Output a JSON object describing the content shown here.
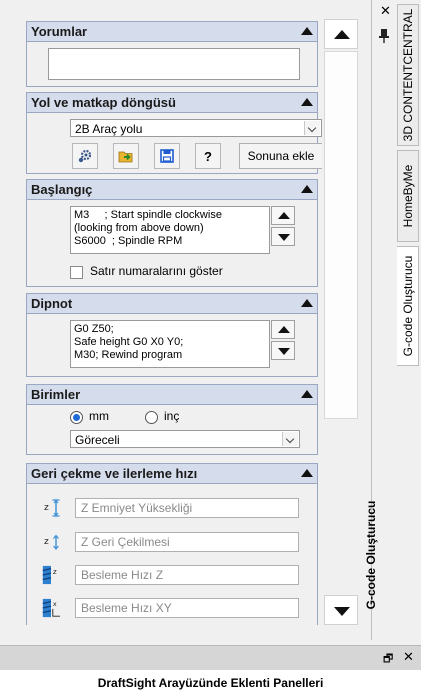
{
  "sections": {
    "comments": {
      "title": "Yorumlar",
      "text": ""
    },
    "toolpath": {
      "title": "Yol ve matkap döngüsü",
      "dropdown_value": "2B Araç yolu",
      "icons": [
        "gear-icon",
        "open-folder-icon",
        "save-icon",
        "help-icon"
      ],
      "help_label": "?",
      "append_label": "Sonuna ekle"
    },
    "start": {
      "title": "Başlangıç",
      "code": "M3     ; Start spindle clockwise\n(looking from above down)\nS6000  ; Spindle RPM",
      "checkbox_label": "Satır numaralarını göster",
      "checkbox_checked": false
    },
    "footer": {
      "title": "Dipnot",
      "code": "G0 Z50;\nSafe height G0 X0 Y0;\nM30; Rewind program"
    },
    "units": {
      "title": "Birimler",
      "radio_mm": "mm",
      "radio_inch": "inç",
      "selected": "mm",
      "dropdown_value": "Göreceli"
    },
    "feed": {
      "title": "Geri çekme ve ilerleme hızı",
      "fields": [
        {
          "placeholder": "Z Emniyet Yüksekliği",
          "icon": "z-safety-height-icon"
        },
        {
          "placeholder": "Z Geri Çekilmesi",
          "icon": "z-retract-icon"
        },
        {
          "placeholder": "Besleme Hızı Z",
          "icon": "feed-rate-z-icon"
        },
        {
          "placeholder": "Besleme Hızı XY",
          "icon": "feed-rate-xy-icon"
        }
      ]
    }
  },
  "panel_title": "G-code Oluşturucu",
  "tabs": [
    "3D CONTENTCENTRAL",
    "HomeByMe",
    "G-code Oluşturucu"
  ],
  "active_tab": "G-code Oluşturucu",
  "caption": "DraftSight Arayüzünde Eklenti Panelleri",
  "colors": {
    "header_bg": "#d5dcec",
    "header_border": "#9aa7c3",
    "radio_accent": "#1e6ad6"
  }
}
